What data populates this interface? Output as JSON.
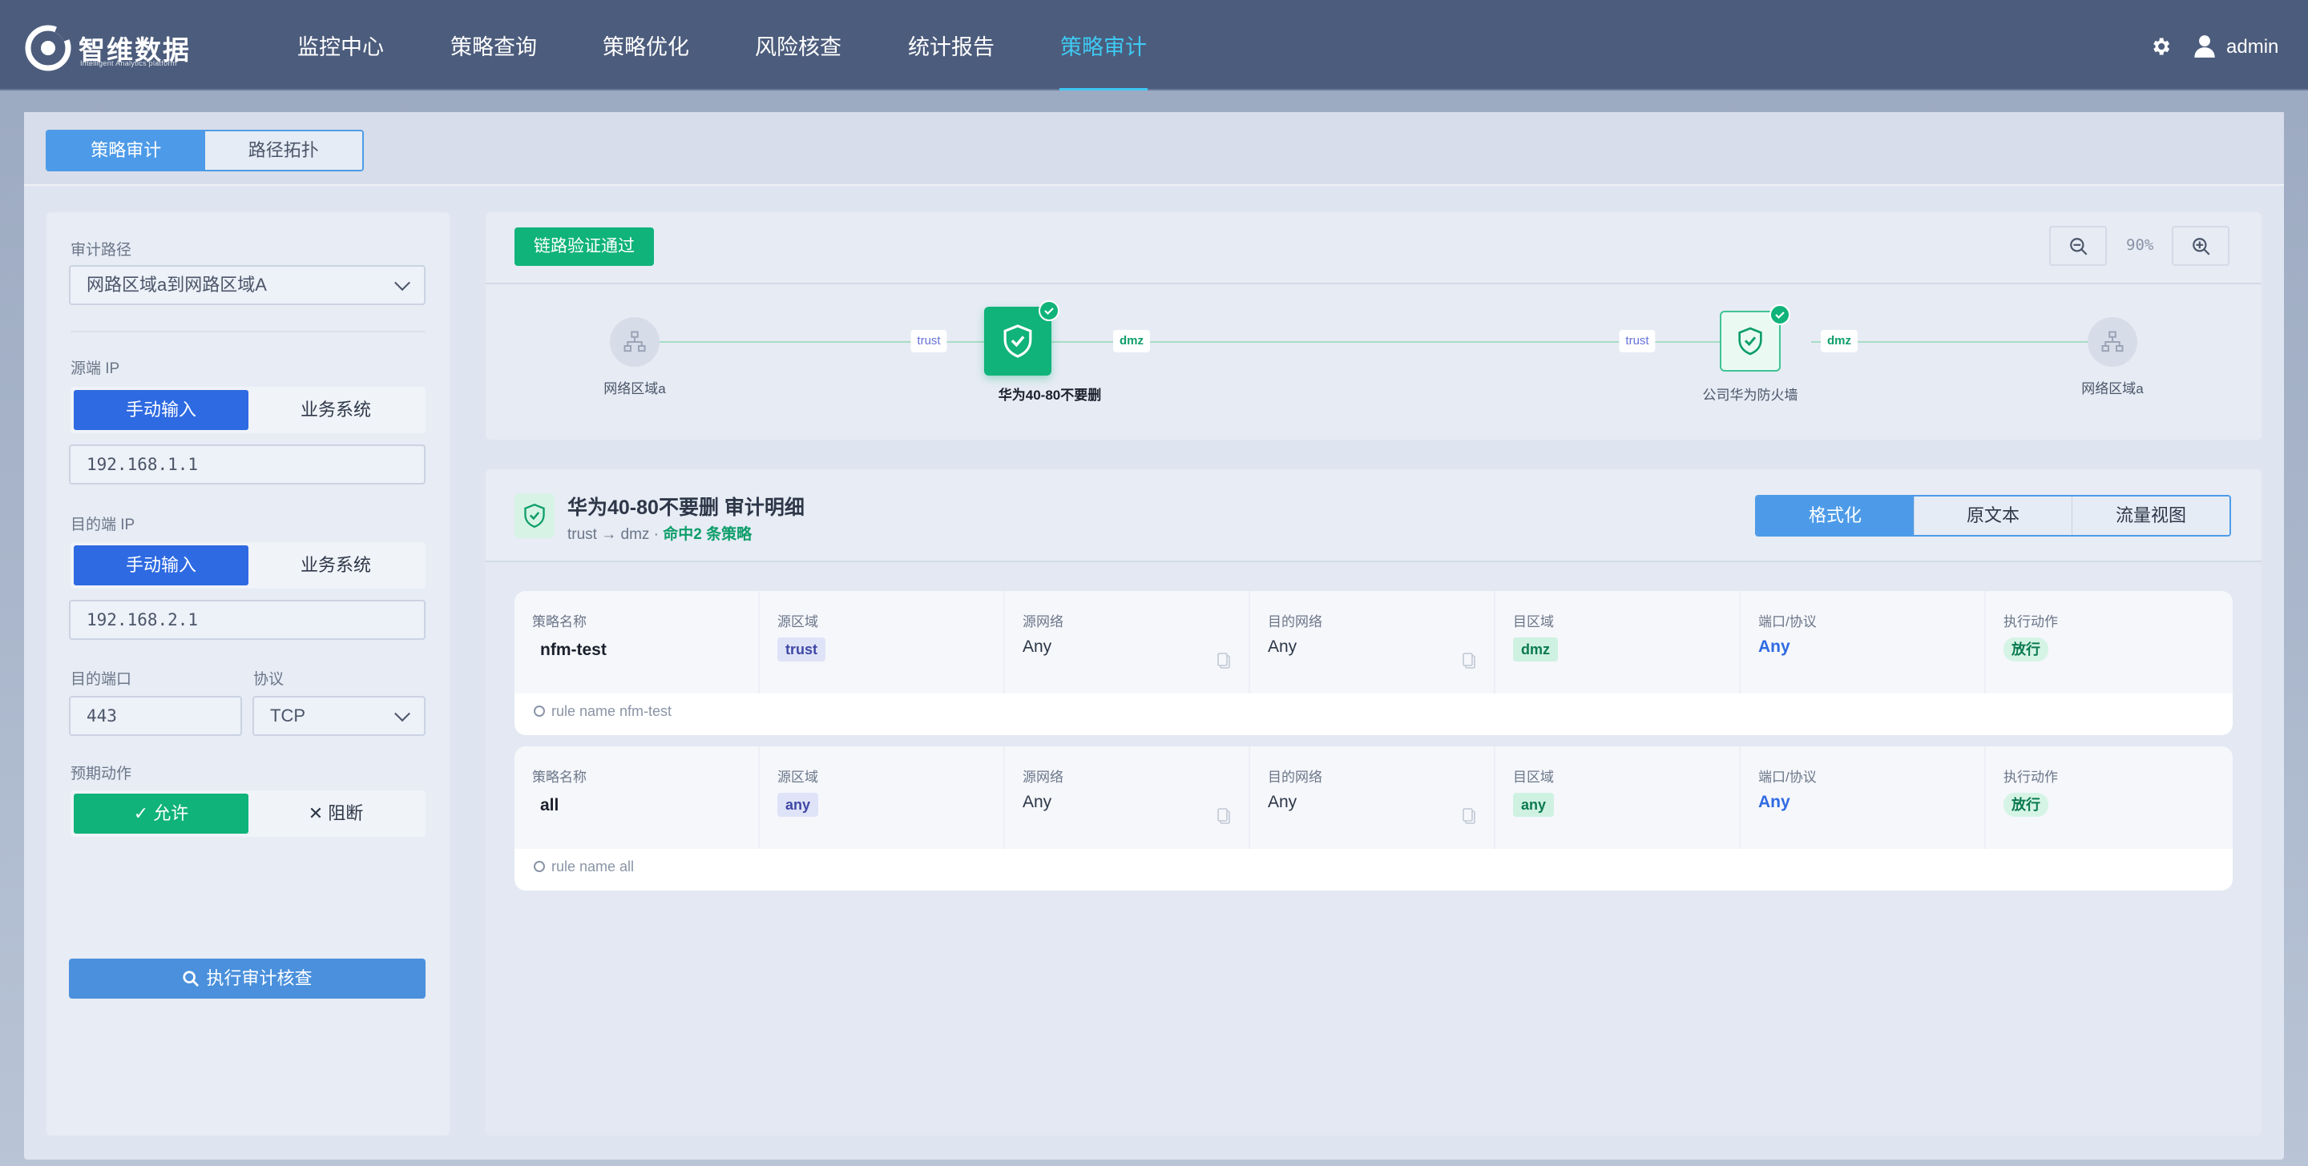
{
  "brand": {
    "name": "智维数据",
    "tagline": "Intelligent Analytics platform"
  },
  "nav": [
    {
      "label": "监控中心"
    },
    {
      "label": "策略查询"
    },
    {
      "label": "策略优化"
    },
    {
      "label": "风险核查"
    },
    {
      "label": "统计报告"
    },
    {
      "label": "策略审计",
      "active": true
    }
  ],
  "user": {
    "name": "admin"
  },
  "colors": {
    "accent": "#3ec9f2",
    "primary": "#2e6ae2",
    "success": "#10b37a",
    "topbar": "#4c5c7c"
  },
  "tabs": [
    {
      "label": "策略审计",
      "active": true
    },
    {
      "label": "路径拓扑"
    }
  ],
  "form": {
    "path_label": "审计路径",
    "path_value": "网路区域a到网路区域A",
    "src_ip_label": "源端 IP",
    "src_mode": {
      "manual": "手动输入",
      "system": "业务系统",
      "selected": "manual"
    },
    "src_ip": "192.168.1.1",
    "dst_ip_label": "目的端 IP",
    "dst_mode": {
      "manual": "手动输入",
      "system": "业务系统",
      "selected": "manual"
    },
    "dst_ip": "192.168.2.1",
    "port_label": "目的端口",
    "port": "443",
    "proto_label": "协议",
    "proto": "TCP",
    "action_label": "预期动作",
    "allow_label": "✓ 允许",
    "deny_label": "✕ 阻断",
    "selected_action": "allow",
    "run_label": "执行审计核查"
  },
  "topology": {
    "status": "链路验证通过",
    "zoom": "90%",
    "nodes": [
      {
        "type": "zone",
        "label": "网络区域a"
      },
      {
        "type": "firewall",
        "label": "华为40-80不要删",
        "selected": true,
        "verified": true
      },
      {
        "type": "firewall",
        "label": "公司华为防火墙",
        "verified": true
      },
      {
        "type": "zone",
        "label": "网络区域a"
      }
    ],
    "zone_tags": [
      "trust",
      "dmz",
      "trust",
      "dmz"
    ]
  },
  "detail": {
    "title": "华为40-80不要删 审计明细",
    "sub_prefix": "trust → dmz · ",
    "sub_hit": "命中2 条策略",
    "views": [
      {
        "label": "格式化",
        "active": true
      },
      {
        "label": "原文本"
      },
      {
        "label": "流量视图"
      }
    ],
    "columns": [
      "策略名称",
      "源区域",
      "源网络",
      "目的网络",
      "目区域",
      "端口/协议",
      "执行动作"
    ],
    "rules": [
      {
        "name": "nfm-test",
        "src_zone": "trust",
        "src_net": "Any",
        "dst_net": "Any",
        "dst_zone": "dmz",
        "port": "Any",
        "action": "放行",
        "raw": "rule name nfm-test"
      },
      {
        "name": "all",
        "src_zone": "any",
        "src_net": "Any",
        "dst_net": "Any",
        "dst_zone": "any",
        "port": "Any",
        "action": "放行",
        "raw": "rule name all"
      }
    ]
  }
}
